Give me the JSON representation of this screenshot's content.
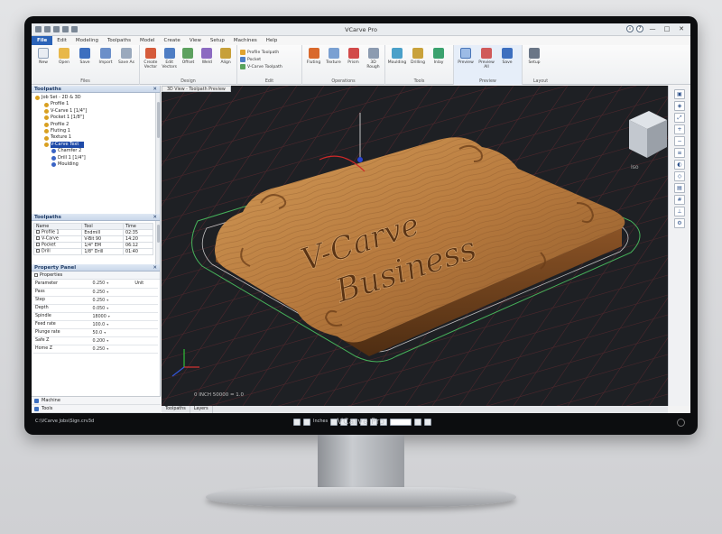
{
  "app": {
    "title": "VCarve Pro",
    "brand_bezel": "VCarve Pro"
  },
  "menu": {
    "file": "File",
    "items": [
      "Edit",
      "Modeling",
      "Toolpaths",
      "Model",
      "Create",
      "View",
      "Setup",
      "Machines",
      "Help"
    ]
  },
  "ribbon": {
    "groups": [
      {
        "label": "Files",
        "buttons": [
          "New",
          "Open",
          "Save",
          "Import",
          "Save As"
        ]
      },
      {
        "label": "Design",
        "buttons": [
          "Create Vector",
          "Edit Vectors",
          "Offset",
          "Weld",
          "Align"
        ]
      },
      {
        "label": "Edit",
        "small": [
          "Profile Toolpath",
          "Pocket",
          "V-Carve Toolpath"
        ]
      },
      {
        "label": "Operations",
        "buttons": [
          "Fluting",
          "Texture",
          "Prism",
          "3D Rough"
        ]
      },
      {
        "label": "Tools",
        "buttons": [
          "Moulding",
          "Drilling",
          "Inlay"
        ]
      },
      {
        "label": "Preview",
        "buttons": [
          "Preview",
          "Preview All",
          "Save"
        ]
      },
      {
        "label": "Layout",
        "buttons": [
          "Setup"
        ]
      }
    ]
  },
  "panels": {
    "toolpaths_title": "Toolpaths",
    "tree": [
      {
        "label": "Job Set - 2D & 3D",
        "type": "root"
      },
      {
        "label": "Profile 1",
        "type": "item"
      },
      {
        "label": "V-Carve 1 [1/4\"]",
        "type": "item"
      },
      {
        "label": "Pocket 1 [1/8\"]",
        "type": "item"
      },
      {
        "label": "Profile 2",
        "type": "item"
      },
      {
        "label": "Fluting 1",
        "type": "item"
      },
      {
        "label": "Texture 1",
        "type": "item"
      },
      {
        "label": "V-Carve Text",
        "type": "selected"
      },
      {
        "label": "Chamfer 2",
        "type": "sub"
      },
      {
        "label": "Drill 1 [1/4\"]",
        "type": "sub"
      },
      {
        "label": "Moulding",
        "type": "sub"
      }
    ],
    "list_title": "Toolpaths",
    "list_columns": [
      "Name",
      "Tool",
      "Time"
    ],
    "list_rows": [
      [
        "Profile 1",
        "Endmill",
        "02:35"
      ],
      [
        "V-Carve",
        "V-Bit 90",
        "14:20"
      ],
      [
        "Pocket",
        "1/4\" EM",
        "06:12"
      ],
      [
        "Drill",
        "1/8\" Drill",
        "01:40"
      ]
    ],
    "props_title": "Property Panel",
    "props_sub": "Properties",
    "props": [
      [
        "Parameter",
        "0.250",
        "Unit"
      ],
      [
        "Pass",
        "0.250",
        ""
      ],
      [
        "Step",
        "0.250",
        ""
      ],
      [
        "Depth",
        "0.050",
        ""
      ],
      [
        "Spindle",
        "18000",
        ""
      ],
      [
        "Feed rate",
        "100.0",
        ""
      ],
      [
        "Plunge rate",
        "50.0",
        ""
      ],
      [
        "Safe Z",
        "0.200",
        ""
      ],
      [
        "Home Z",
        "0.250",
        ""
      ]
    ],
    "tools": [
      "Machine",
      "Tools"
    ]
  },
  "viewport": {
    "tab_label": "3D View - Toolpath Preview",
    "scale_text": "0 INCH 50000 = 1.0",
    "view_cube_label": "Iso",
    "plaque_line1": "V-Carve",
    "plaque_line2": "Business",
    "colors": {
      "wood_light": "#c48a4a",
      "wood_dark": "#7a4b22",
      "grid": "#5a2a30",
      "outline_green": "#46b25a",
      "outline_white": "#e8e8e8"
    }
  },
  "bottom_tabs": [
    "Toolpaths",
    "Layers"
  ],
  "status": {
    "left": "C:\\VCarve Jobs\\Sign.crv3d",
    "units": "Inches"
  }
}
